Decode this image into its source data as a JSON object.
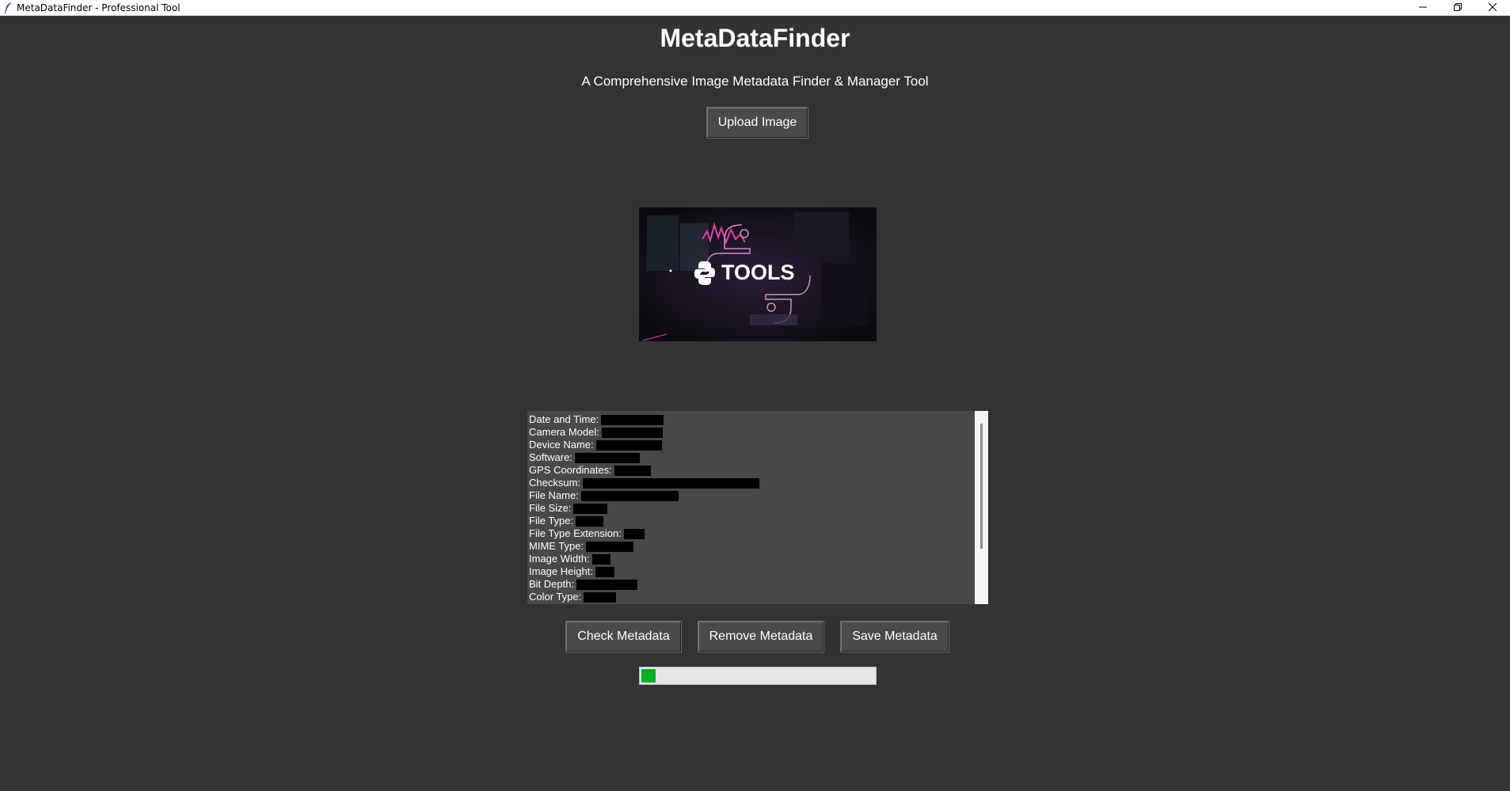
{
  "window": {
    "title": "MetaDataFinder - Professional Tool",
    "icons": [
      "feather-icon",
      "minimize-icon",
      "restore-icon",
      "close-icon"
    ]
  },
  "header": {
    "title": "MetaDataFinder",
    "subtitle": "A Comprehensive Image Metadata Finder & Manager Tool"
  },
  "upload_label": "Upload Image",
  "preview": {
    "text": "TOOLS",
    "icon": "python-logo-icon",
    "accent": "#e23da8"
  },
  "metadata": {
    "fields": [
      "Date and Time:",
      "Camera Model:",
      "Device Name:",
      "Software:",
      "GPS Coordinates:",
      "Checksum:",
      "File Name:",
      "File Size:",
      "File Type:",
      "File Type Extension:",
      "MIME Type:",
      "Image Width:",
      "Image Height:",
      "Bit Depth:",
      "Color Type:"
    ]
  },
  "actions": {
    "check_label": "Check Metadata",
    "remove_label": "Remove Metadata",
    "save_label": "Save Metadata"
  },
  "progress": {
    "value": 0.06,
    "color": "#06b025"
  },
  "colors": {
    "background": "#333333",
    "button": "#4a4a4a",
    "panel": "#484848"
  }
}
